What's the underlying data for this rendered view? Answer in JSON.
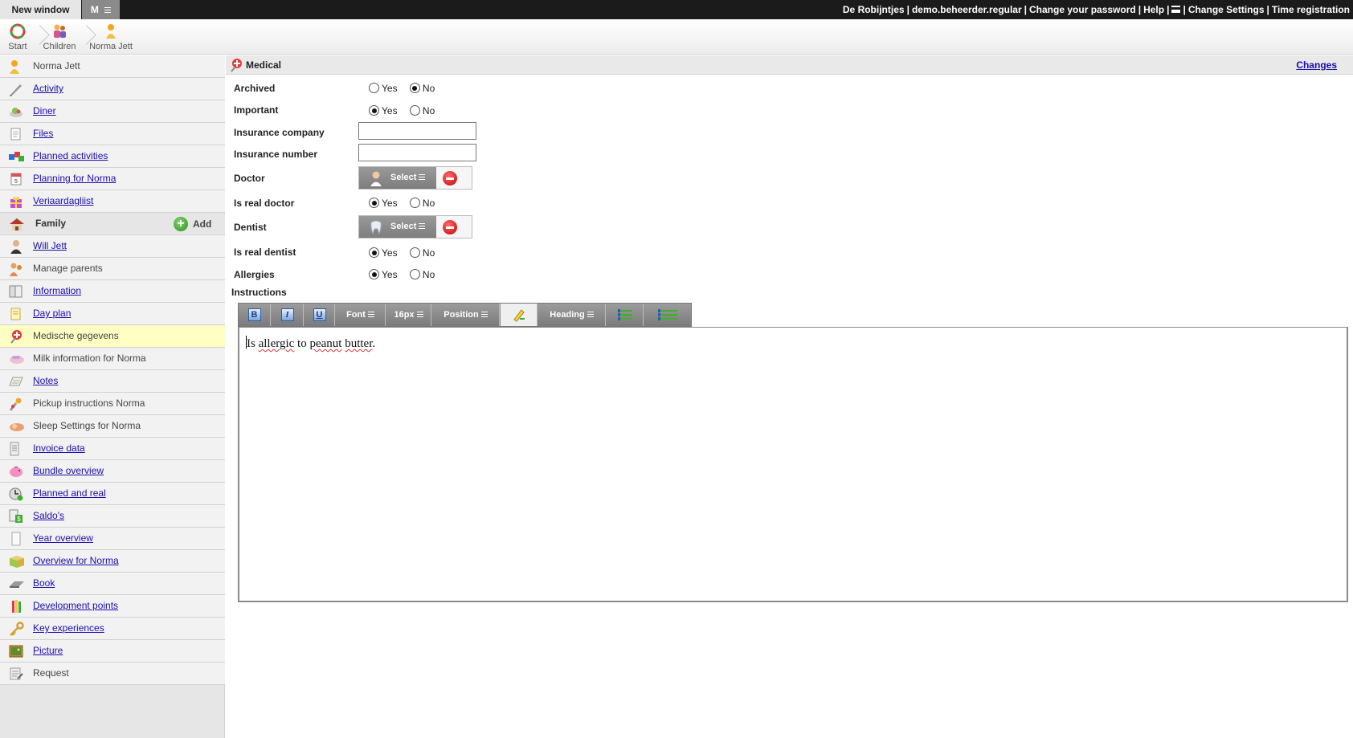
{
  "topbar": {
    "tab_new_window": "New window",
    "tab_menu": "M",
    "org": "De Robijntjes",
    "user": "demo.beheerder.regular",
    "change_password": "Change your password",
    "help": "Help",
    "change_settings": "Change Settings",
    "time_registration": "Time registration",
    "separator": "|"
  },
  "breadcrumb": {
    "items": [
      {
        "label": "Start",
        "icon": "start-icon"
      },
      {
        "label": "Children",
        "icon": "children-icon"
      },
      {
        "label": "Norma Jett",
        "icon": "child-icon"
      }
    ]
  },
  "sidebar": {
    "child_name": "Norma Jett",
    "items": [
      {
        "label": "Activity",
        "link": true,
        "icon": "pencil-icon"
      },
      {
        "label": "Diner",
        "link": true,
        "icon": "food-icon"
      },
      {
        "label": "Files",
        "link": true,
        "icon": "files-icon"
      },
      {
        "label": "Planned activities",
        "link": true,
        "icon": "puzzle-icon"
      },
      {
        "label": "Planning for Norma",
        "link": true,
        "icon": "calendar-icon"
      },
      {
        "label": "Veriaardagliist",
        "link": true,
        "icon": "gift-icon"
      }
    ],
    "family_header": "Family",
    "add_label": "Add",
    "family_items": [
      {
        "label": "Will Jett",
        "link": true,
        "icon": "person-icon"
      },
      {
        "label": "Manage parents",
        "link": false,
        "icon": "parents-icon"
      },
      {
        "label": "Information",
        "link": true,
        "icon": "info-icon"
      },
      {
        "label": "Day plan",
        "link": true,
        "icon": "dayplan-icon"
      },
      {
        "label": "Medische gegevens",
        "link": false,
        "active": true,
        "icon": "medical-icon"
      },
      {
        "label": "Milk information for Norma",
        "link": false,
        "icon": "milk-icon"
      },
      {
        "label": "Notes",
        "link": true,
        "icon": "notes-icon"
      },
      {
        "label": "Pickup instructions Norma",
        "link": false,
        "icon": "pickup-icon"
      },
      {
        "label": "Sleep Settings for Norma",
        "link": false,
        "icon": "sleep-icon"
      },
      {
        "label": "Invoice data",
        "link": true,
        "icon": "invoice-icon"
      },
      {
        "label": "Bundle overview",
        "link": true,
        "icon": "piggybank-icon"
      },
      {
        "label": "Planned and real",
        "link": true,
        "icon": "clock-icon"
      },
      {
        "label": "Saldo's",
        "link": true,
        "icon": "saldo-icon"
      },
      {
        "label": "Year overview",
        "link": true,
        "icon": "document-icon"
      },
      {
        "label": "Overview for Norma",
        "link": true,
        "icon": "box-icon"
      },
      {
        "label": "Book",
        "link": true,
        "icon": "book-icon"
      },
      {
        "label": "Development points",
        "link": true,
        "icon": "crayons-icon"
      },
      {
        "label": "Key experiences",
        "link": true,
        "icon": "key-icon"
      },
      {
        "label": "Picture",
        "link": true,
        "icon": "picture-icon"
      },
      {
        "label": "Request",
        "link": false,
        "icon": "request-icon"
      }
    ]
  },
  "main": {
    "title": "Medical",
    "changes": "Changes",
    "yes": "Yes",
    "no": "No",
    "fields": {
      "archived": {
        "label": "Archived",
        "value": "No"
      },
      "important": {
        "label": "Important",
        "value": "Yes"
      },
      "insurance_company": {
        "label": "Insurance company",
        "value": ""
      },
      "insurance_number": {
        "label": "Insurance number",
        "value": ""
      },
      "doctor": {
        "label": "Doctor",
        "select_label": "Select"
      },
      "is_real_doctor": {
        "label": "Is real doctor",
        "value": "Yes"
      },
      "dentist": {
        "label": "Dentist",
        "select_label": "Select"
      },
      "is_real_dentist": {
        "label": "Is real dentist",
        "value": "Yes"
      },
      "allergies": {
        "label": "Allergies",
        "value": "Yes"
      },
      "instructions": {
        "label": "Instructions"
      }
    },
    "editor": {
      "toolbar": {
        "bold": "B",
        "italic": "I",
        "underline": "U",
        "font": "Font",
        "size": "16px",
        "position": "Position",
        "heading": "Heading"
      },
      "content": {
        "w1": "Is",
        "w2": "allergic",
        "w3": "to",
        "w4": "peanut",
        "w5": "butter",
        "end": "."
      }
    }
  }
}
